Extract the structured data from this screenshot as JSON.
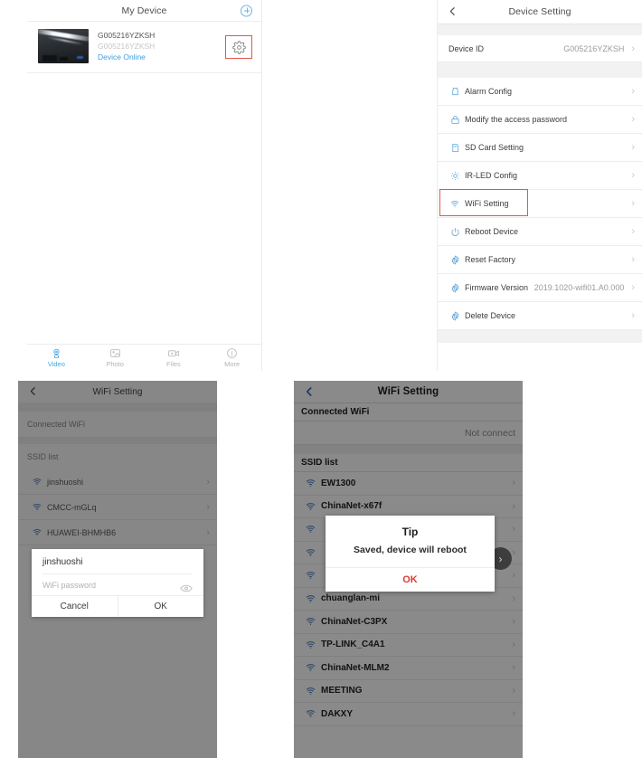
{
  "panel1": {
    "title": "My Device",
    "add_icon": "plus-circle-icon",
    "device": {
      "id": "G005216YZKSH",
      "id_secondary": "G005216YZKSH",
      "status": "Device Online",
      "status_color": "#3ea0e0",
      "settings_icon": "gear-icon",
      "highlight_color": "#e2574c"
    },
    "tabs": [
      {
        "label": "Video",
        "icon": "camera-icon",
        "active": true
      },
      {
        "label": "Photo",
        "icon": "image-icon",
        "active": false
      },
      {
        "label": "Files",
        "icon": "video-file-icon",
        "active": false
      },
      {
        "label": "More",
        "icon": "info-icon",
        "active": false
      }
    ]
  },
  "panel2": {
    "title": "Device Setting",
    "back_icon": "chevron-left-icon",
    "device_id_row": {
      "label": "Device ID",
      "value": "G005216YZKSH"
    },
    "items": [
      {
        "label": "Alarm Config",
        "icon": "alarm-bell-icon",
        "value": ""
      },
      {
        "label": "Modify the access password",
        "icon": "lock-icon",
        "value": ""
      },
      {
        "label": "SD Card Setting",
        "icon": "sd-card-icon",
        "value": ""
      },
      {
        "label": "IR-LED Config",
        "icon": "led-light-icon",
        "value": ""
      },
      {
        "label": "WiFi Setting",
        "icon": "wifi-icon",
        "value": "",
        "highlighted": true
      },
      {
        "label": "Reboot Device",
        "icon": "power-icon",
        "value": ""
      },
      {
        "label": "Reset Factory",
        "icon": "gear-icon",
        "value": ""
      },
      {
        "label": "Firmware Version",
        "icon": "gear-icon",
        "value": "2019.1020-wifi01.A0.000"
      },
      {
        "label": "Delete Device",
        "icon": "gear-icon",
        "value": ""
      }
    ],
    "highlight_color": "#e2574c"
  },
  "panel3": {
    "title": "WiFi Setting",
    "back_icon": "chevron-left-icon",
    "connected_header": "Connected WiFi",
    "ssid_header": "SSID list",
    "ssid_list": [
      {
        "label": "jinshuoshi",
        "icon": "wifi-icon"
      },
      {
        "label": "CMCC-mGLq",
        "icon": "wifi-icon"
      },
      {
        "label": "HUAWEI-BHMHB6",
        "icon": "wifi-icon"
      }
    ],
    "dialog": {
      "title": "jinshuoshi",
      "password_placeholder": "WiFi password",
      "password_value": "",
      "eye_icon": "eye-icon",
      "cancel_label": "Cancel",
      "ok_label": "OK"
    }
  },
  "panel4": {
    "title": "WiFi Setting",
    "back_icon": "chevron-left-icon",
    "connected_header": "Connected WiFi",
    "connected_status": "Not connect",
    "ssid_header": "SSID list",
    "ssid_list": [
      {
        "label": "EW1300",
        "icon": "wifi-icon"
      },
      {
        "label": "ChinaNet-x67f",
        "icon": "wifi-icon"
      },
      {
        "label": "",
        "icon": "wifi-icon"
      },
      {
        "label": "",
        "icon": "wifi-icon"
      },
      {
        "label": "",
        "icon": "wifi-icon"
      },
      {
        "label": "chuanglan-mi",
        "icon": "wifi-icon"
      },
      {
        "label": "ChinaNet-C3PX",
        "icon": "wifi-icon"
      },
      {
        "label": "TP-LINK_C4A1",
        "icon": "wifi-icon"
      },
      {
        "label": "ChinaNet-MLM2",
        "icon": "wifi-icon"
      },
      {
        "label": "MEETING",
        "icon": "wifi-icon"
      },
      {
        "label": "DAKXY",
        "icon": "wifi-icon"
      }
    ],
    "dialog": {
      "title": "Tip",
      "message": "Saved, device will reboot",
      "ok_label": "OK",
      "ok_color": "#e03a2f"
    },
    "cursor_icon": "tap-chevron-indicator"
  }
}
